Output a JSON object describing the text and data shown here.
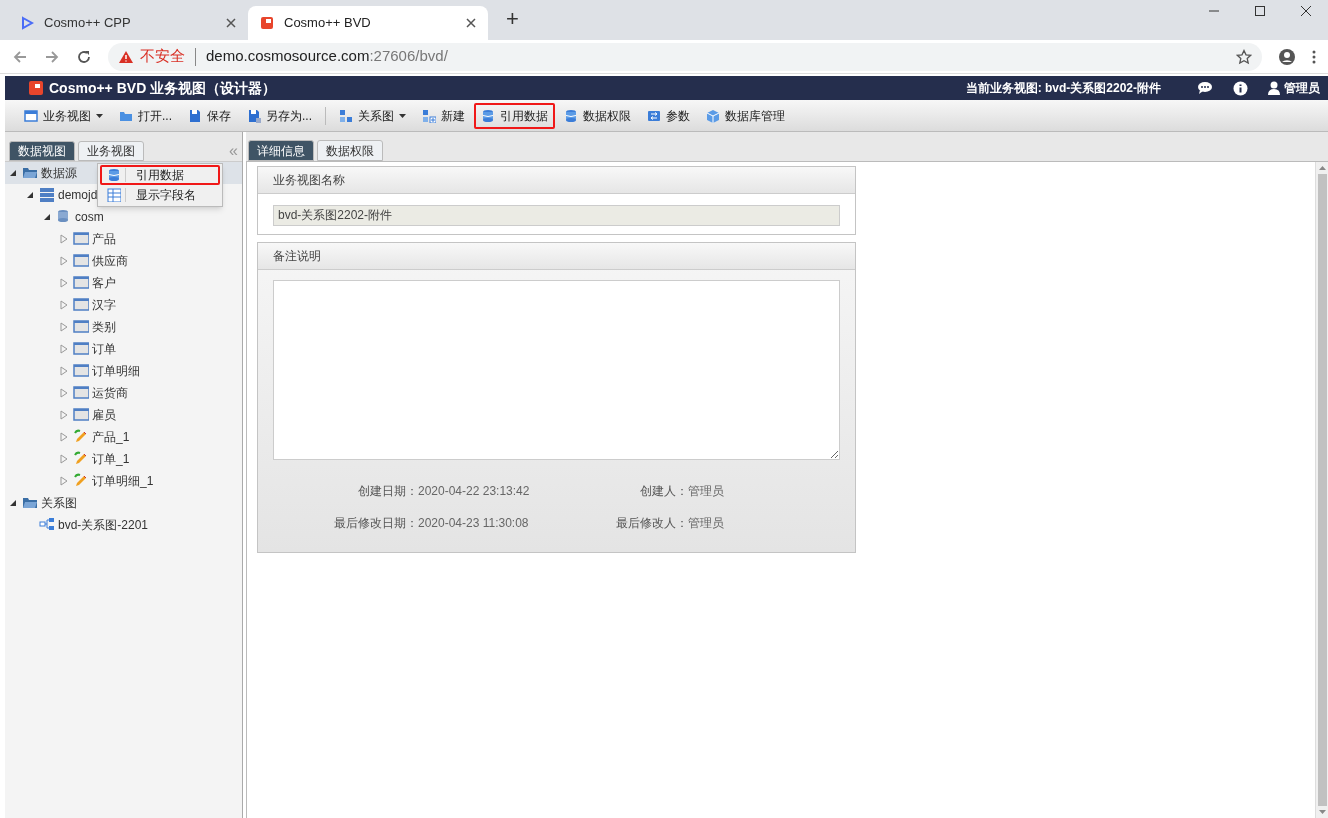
{
  "browser": {
    "tabs": [
      {
        "title": "Cosmo++ CPP",
        "selected": false
      },
      {
        "title": "Cosmo++ BVD",
        "selected": true
      }
    ],
    "new_tab": "+",
    "security": "不安全",
    "url_host": "demo.cosmosource.com",
    "url_rest": ":27606/bvd/"
  },
  "app": {
    "title": "Cosmo++ BVD 业务视图（设计器）",
    "current_view": "当前业务视图: bvd-关系图2202-附件",
    "user": "管理员"
  },
  "toolbar": [
    {
      "kind": "view",
      "label": "业务视图",
      "dropdown": true,
      "highlighted": false
    },
    {
      "kind": "open",
      "label": "打开...",
      "dropdown": false,
      "highlighted": false
    },
    {
      "kind": "save",
      "label": "保存",
      "dropdown": false,
      "highlighted": false
    },
    {
      "kind": "saveas",
      "label": "另存为...",
      "dropdown": false,
      "highlighted": false
    },
    {
      "kind": "separator"
    },
    {
      "kind": "diagram",
      "label": "关系图",
      "dropdown": true,
      "highlighted": false
    },
    {
      "kind": "new",
      "label": "新建",
      "dropdown": false,
      "highlighted": false
    },
    {
      "kind": "data",
      "label": "引用数据",
      "dropdown": false,
      "highlighted": true
    },
    {
      "kind": "data",
      "label": "数据权限",
      "dropdown": false,
      "highlighted": false
    },
    {
      "kind": "param",
      "label": "参数",
      "dropdown": false,
      "highlighted": false
    },
    {
      "kind": "cube",
      "label": "数据库管理",
      "dropdown": false,
      "highlighted": false
    }
  ],
  "left_tabs": [
    {
      "label": "数据视图",
      "selected": true
    },
    {
      "label": "业务视图",
      "selected": false
    }
  ],
  "collapse": "«",
  "tree": [
    {
      "kind": "folder",
      "label": "数据源",
      "expanded": true,
      "selected": true,
      "children": [
        {
          "kind": "server",
          "label": "demojd",
          "expanded": true,
          "selected": false,
          "children": [
            {
              "kind": "database",
              "label": "cosm",
              "expanded": true,
              "selected": false,
              "children": [
                {
                  "kind": "table",
                  "label": "产品",
                  "expanded": false,
                  "selected": false
                },
                {
                  "kind": "table",
                  "label": "供应商",
                  "expanded": false,
                  "selected": false
                },
                {
                  "kind": "table",
                  "label": "客户",
                  "expanded": false,
                  "selected": false
                },
                {
                  "kind": "table",
                  "label": "汉字",
                  "expanded": false,
                  "selected": false
                },
                {
                  "kind": "table",
                  "label": "类别",
                  "expanded": false,
                  "selected": false
                },
                {
                  "kind": "table",
                  "label": "订单",
                  "expanded": false,
                  "selected": false
                },
                {
                  "kind": "table",
                  "label": "订单明细",
                  "expanded": false,
                  "selected": false
                },
                {
                  "kind": "table",
                  "label": "运货商",
                  "expanded": false,
                  "selected": false
                },
                {
                  "kind": "table",
                  "label": "雇员",
                  "expanded": false,
                  "selected": false
                },
                {
                  "kind": "edited",
                  "label": "产品_1",
                  "expanded": false,
                  "selected": false
                },
                {
                  "kind": "edited",
                  "label": "订单_1",
                  "expanded": false,
                  "selected": false
                },
                {
                  "kind": "edited",
                  "label": "订单明细_1",
                  "expanded": false,
                  "selected": false
                }
              ]
            }
          ]
        }
      ]
    },
    {
      "kind": "folder",
      "label": "关系图",
      "expanded": true,
      "selected": false,
      "children": [
        {
          "kind": "diagram",
          "label": "bvd-关系图-2201",
          "selected": false
        }
      ]
    }
  ],
  "context_menu": [
    {
      "kind": "data",
      "label": "引用数据",
      "highlighted": true
    },
    {
      "kind": "fields",
      "label": "显示字段名",
      "highlighted": false
    }
  ],
  "right_tabs": [
    {
      "label": "详细信息",
      "selected": true
    },
    {
      "label": "数据权限",
      "selected": false
    }
  ],
  "name_panel": {
    "title": "业务视图名称",
    "value": "bvd-关系图2202-附件"
  },
  "note_panel": {
    "title": "备注说明",
    "meta": [
      {
        "label": "创建日期：",
        "value": "2020-04-22 23:13:42"
      },
      {
        "label": "创建人：",
        "value": "管理员"
      },
      {
        "label": "最后修改日期：",
        "value": "2020-04-23 11:30:08"
      },
      {
        "label": "最后修改人：",
        "value": "管理员"
      }
    ]
  }
}
